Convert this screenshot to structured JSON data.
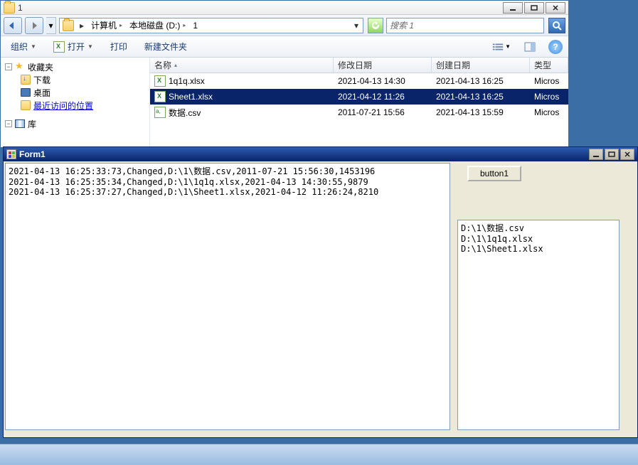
{
  "explorer": {
    "title": "1",
    "breadcrumb": [
      "计算机",
      "本地磁盘 (D:)",
      "1"
    ],
    "search_placeholder": "搜索 1",
    "toolbar": {
      "organize": "组织",
      "open": "打开",
      "print": "打印",
      "newfolder": "新建文件夹"
    },
    "nav": {
      "favorites": "收藏夹",
      "downloads": "下载",
      "desktop": "桌面",
      "recent": "最近访问的位置",
      "libs": "库"
    },
    "columns": {
      "name": "名称",
      "modified": "修改日期",
      "created": "创建日期",
      "type": "类型"
    },
    "files": [
      {
        "name": "1q1q.xlsx",
        "modified": "2021-04-13 14:30",
        "created": "2021-04-13 16:25",
        "type": "Micros",
        "icon": "xlsx",
        "selected": false
      },
      {
        "name": "Sheet1.xlsx",
        "modified": "2021-04-12 11:26",
        "created": "2021-04-13 16:25",
        "type": "Micros",
        "icon": "xlsx",
        "selected": true
      },
      {
        "name": "数据.csv",
        "modified": "2011-07-21 15:56",
        "created": "2021-04-13 15:59",
        "type": "Micros",
        "icon": "csv",
        "selected": false
      }
    ]
  },
  "form1": {
    "title": "Form1",
    "button_label": "button1",
    "log_lines": [
      "2021-04-13 16:25:33:73,Changed,D:\\1\\数据.csv,2011-07-21 15:56:30,1453196",
      "2021-04-13 16:25:35:34,Changed,D:\\1\\1q1q.xlsx,2021-04-13 14:30:55,9879",
      "2021-04-13 16:25:37:27,Changed,D:\\1\\Sheet1.xlsx,2021-04-12 11:26:24,8210"
    ],
    "path_lines": [
      "D:\\1\\数据.csv",
      "D:\\1\\1q1q.xlsx",
      "D:\\1\\Sheet1.xlsx"
    ]
  }
}
